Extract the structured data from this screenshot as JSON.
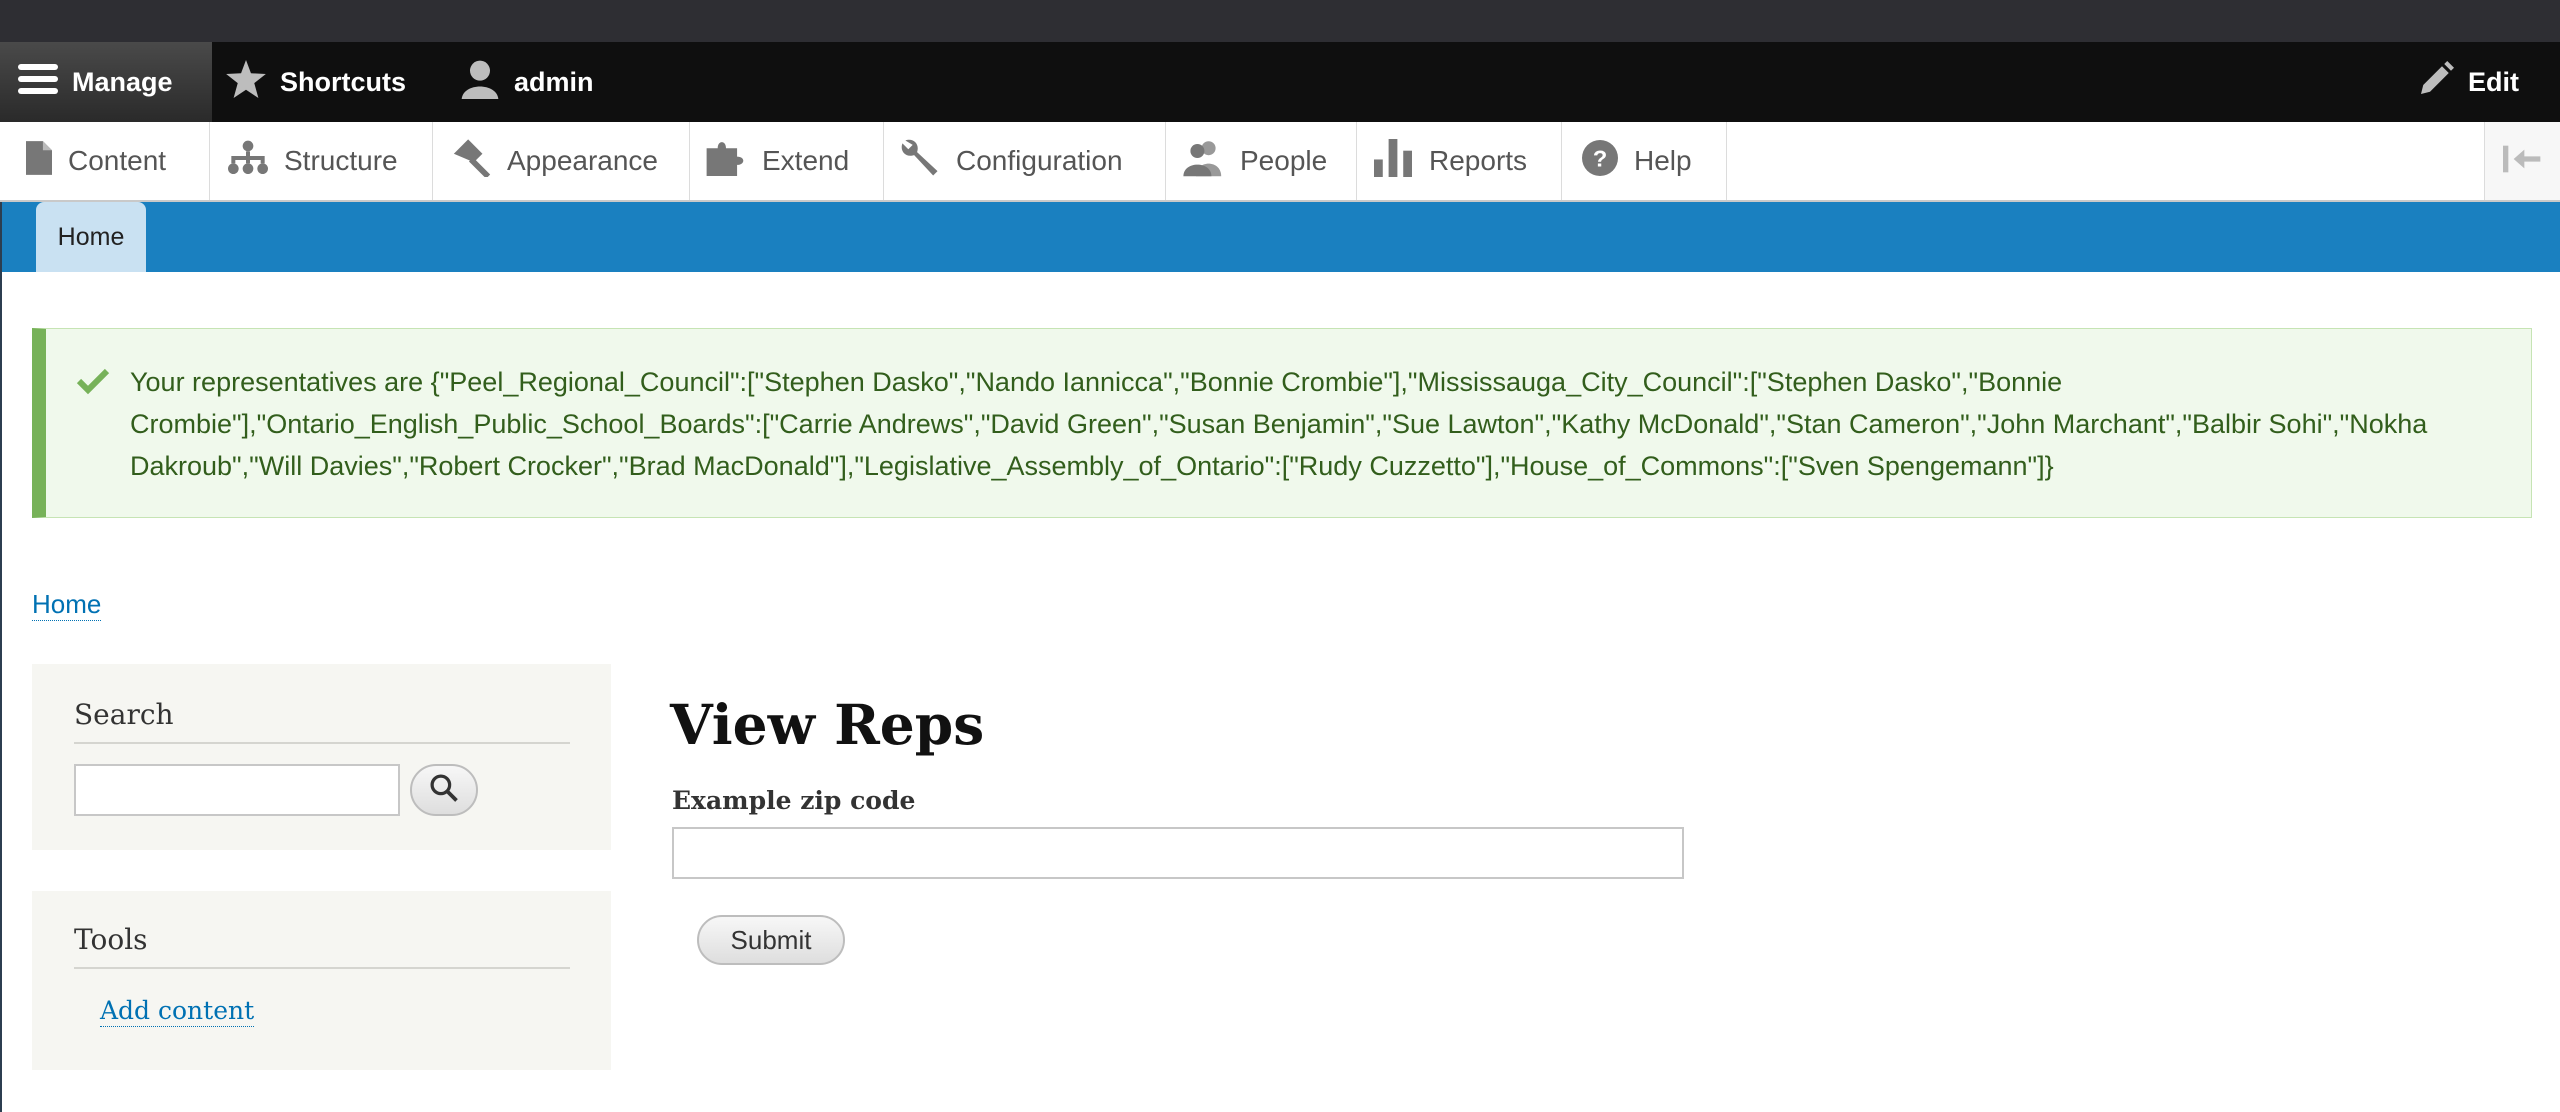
{
  "toolbar": {
    "manage_label": "Manage",
    "shortcuts_label": "Shortcuts",
    "user_label": "admin",
    "edit_label": "Edit"
  },
  "tray": {
    "items": [
      {
        "label": "Content",
        "icon": "file-icon"
      },
      {
        "label": "Structure",
        "icon": "sitemap-icon"
      },
      {
        "label": "Appearance",
        "icon": "paint-roller-icon"
      },
      {
        "label": "Extend",
        "icon": "puzzle-icon"
      },
      {
        "label": "Configuration",
        "icon": "wrench-icon"
      },
      {
        "label": "People",
        "icon": "people-icon"
      },
      {
        "label": "Reports",
        "icon": "bar-chart-icon"
      },
      {
        "label": "Help",
        "icon": "help-icon"
      }
    ]
  },
  "header": {
    "home_tab": "Home"
  },
  "status": {
    "message": "Your representatives are {\"Peel_Regional_Council\":[\"Stephen Dasko\",\"Nando Iannicca\",\"Bonnie Crombie\"],\"Mississauga_City_Council\":[\"Stephen Dasko\",\"Bonnie Crombie\"],\"Ontario_English_Public_School_Boards\":[\"Carrie Andrews\",\"David Green\",\"Susan Benjamin\",\"Sue Lawton\",\"Kathy McDonald\",\"Stan Cameron\",\"John Marchant\",\"Balbir Sohi\",\"Nokha Dakroub\",\"Will Davies\",\"Robert Crocker\",\"Brad MacDonald\"],\"Legislative_Assembly_of_Ontario\":[\"Rudy Cuzzetto\"],\"House_of_Commons\":[\"Sven Spengemann\"]}",
    "color": "#325e1c"
  },
  "breadcrumb": {
    "home": "Home"
  },
  "sidebar": {
    "search_title": "Search",
    "tools_title": "Tools",
    "add_content": "Add content"
  },
  "main": {
    "title": "View Reps",
    "zip_label": "Example zip code",
    "zip_value": "",
    "submit_label": "Submit"
  },
  "colors": {
    "brand_blue": "#1a80c0",
    "link": "#0071b3",
    "status_border": "#77b259"
  }
}
